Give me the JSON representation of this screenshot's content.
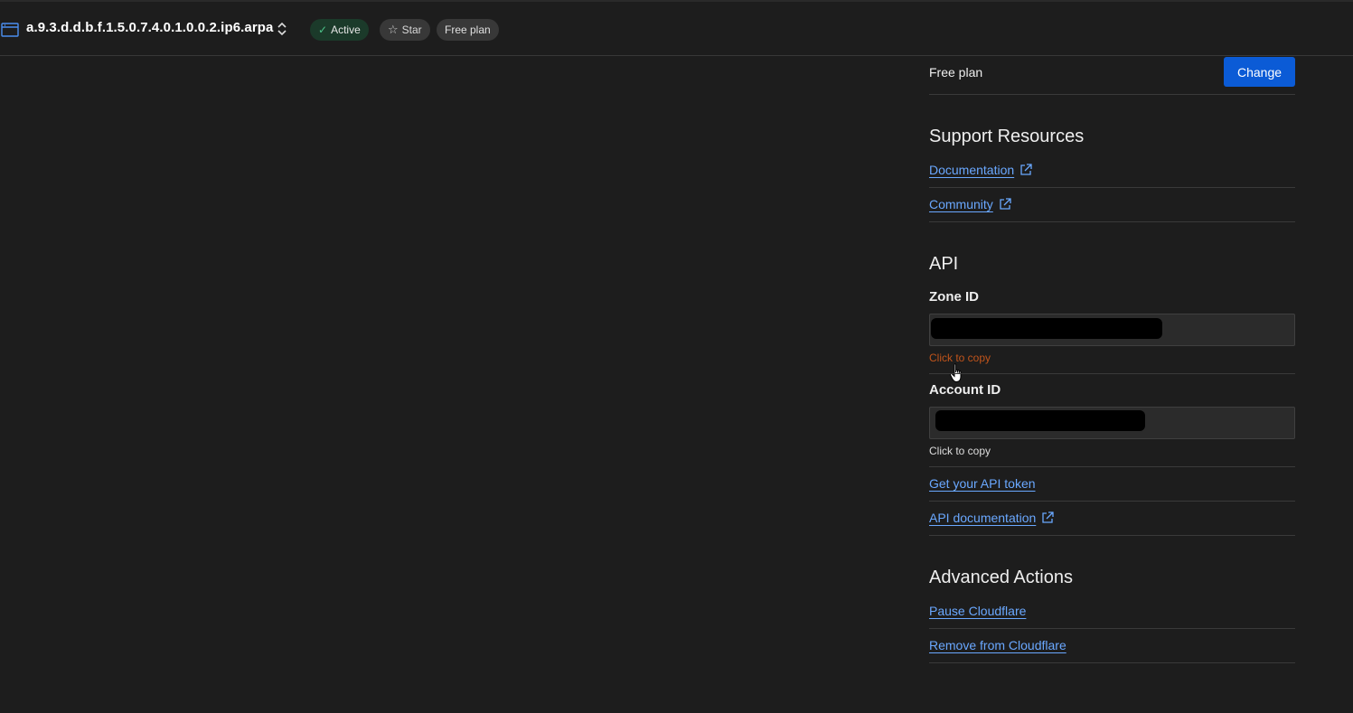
{
  "header": {
    "zone_name": "a.9.3.d.d.b.f.1.5.0.7.4.0.1.0.0.2.ip6.arpa",
    "status_label": "Active",
    "star_label": "Star",
    "plan_badge": "Free plan"
  },
  "plan": {
    "name": "Free plan",
    "change_label": "Change"
  },
  "support": {
    "title": "Support Resources",
    "documentation": "Documentation",
    "community": "Community"
  },
  "api": {
    "title": "API",
    "zone_id_label": "Zone ID",
    "zone_copy_hint": "Click to copy",
    "account_id_label": "Account ID",
    "account_copy_hint": "Click to copy",
    "get_token": "Get your API token",
    "api_docs": "API documentation"
  },
  "advanced": {
    "title": "Advanced Actions",
    "pause": "Pause Cloudflare",
    "remove": "Remove from Cloudflare"
  },
  "colors": {
    "background": "#1d1d1d",
    "link": "#6aa8ff",
    "primary_button": "#0b5bd6",
    "active_pill": "#1b3a2a",
    "hover_hint": "#c0541b"
  },
  "icons": [
    "browser-window-icon",
    "chevron-updown-icon",
    "checkmark-icon",
    "star-icon",
    "external-link-icon",
    "hand-pointer-icon"
  ]
}
